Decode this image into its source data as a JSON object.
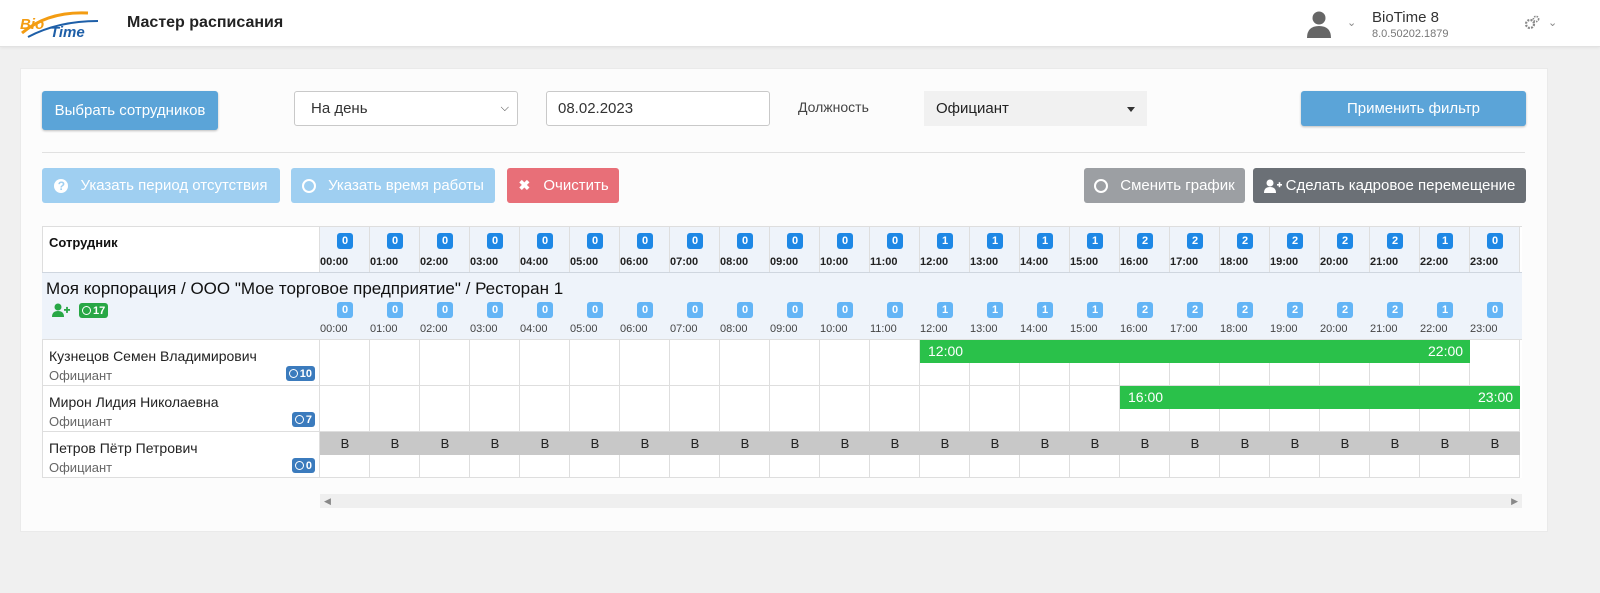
{
  "header": {
    "logo_text": "BioTime",
    "title": "Мастер расписания",
    "brand": "BioTime 8",
    "version": "8.0.50202.1879"
  },
  "filters": {
    "select_employees_label": "Выбрать сотрудников",
    "period_value": "На день",
    "date_value": "08.02.2023",
    "position_label": "Должность",
    "position_value": "Официант",
    "apply_label": "Применить фильтр"
  },
  "actions": {
    "absence_label": "Указать период отсутствия",
    "worktime_label": "Указать время работы",
    "clear_label": "Очистить",
    "change_schedule_label": "Сменить график",
    "transfer_label": "Сделать кадровое перемещение"
  },
  "grid": {
    "employee_header": "Сотрудник",
    "hours": [
      "00:00",
      "01:00",
      "02:00",
      "03:00",
      "04:00",
      "05:00",
      "06:00",
      "07:00",
      "08:00",
      "09:00",
      "10:00",
      "11:00",
      "12:00",
      "13:00",
      "14:00",
      "15:00",
      "16:00",
      "17:00",
      "18:00",
      "19:00",
      "20:00",
      "21:00",
      "22:00",
      "23:00"
    ],
    "counts": [
      0,
      0,
      0,
      0,
      0,
      0,
      0,
      0,
      0,
      0,
      0,
      0,
      1,
      1,
      1,
      1,
      2,
      2,
      2,
      2,
      2,
      2,
      1,
      0
    ],
    "group": {
      "path": "Моя корпорация / ООО \"Мое торговое предприятие\" / Ресторан 1",
      "hours_badge": "17"
    },
    "employees": [
      {
        "name": "Кузнецов Семен Владимирович",
        "position": "Официант",
        "hours": "10",
        "shift_start": 12,
        "shift_end": 22,
        "start_label": "12:00",
        "end_label": "22:00",
        "dayoff": false
      },
      {
        "name": "Мирон Лидия Николаевна",
        "position": "Официант",
        "hours": "7",
        "shift_start": 16,
        "shift_end": 23,
        "start_label": "16:00",
        "end_label": "23:00",
        "dayoff": false
      },
      {
        "name": "Петров Пётр Петрович",
        "position": "Официант",
        "hours": "0",
        "dayoff": true,
        "dayoff_mark": "В"
      }
    ]
  },
  "colors": {
    "header_badge": "#1e88e5",
    "group_badge": "#64b5f6",
    "shift": "#2ac14a",
    "dayoff": "#c8c8c8",
    "hours_badge": "#3b7bbd",
    "group_hours_badge": "#28a745"
  }
}
